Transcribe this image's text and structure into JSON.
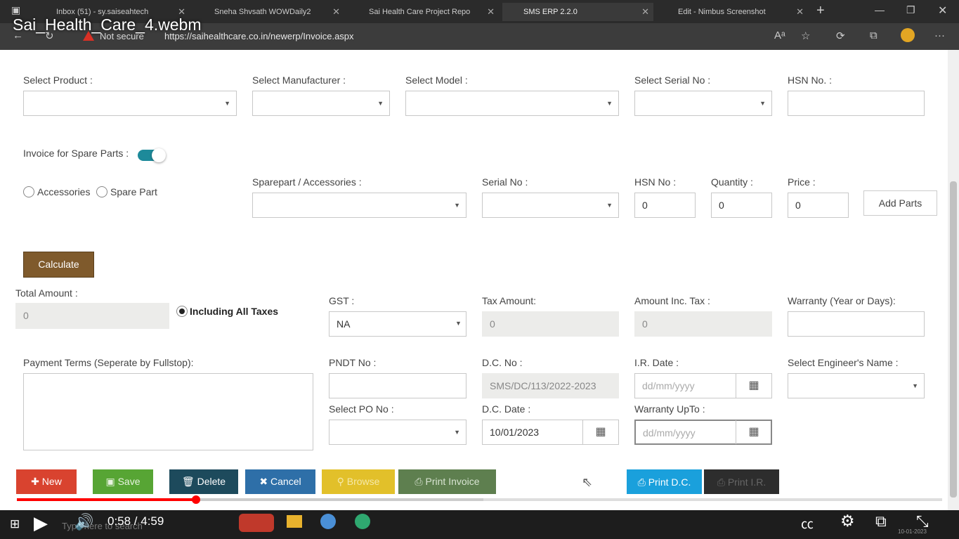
{
  "video": {
    "title": "Sai_Health_Care_4.webm",
    "time": "0:58 / 4:59",
    "progress_played": 0.194,
    "progress_loaded": 0.504
  },
  "browser": {
    "tabs": [
      {
        "label": "Inbox (51) - sy.saiseahtech"
      },
      {
        "label": "Sneha Shvsath WOWDaily2"
      },
      {
        "label": "Sai Health Care Project Repo"
      },
      {
        "label": "SMS ERP 2.2.0"
      },
      {
        "label": "Edit - Nimbus Screenshot"
      }
    ],
    "not_secure": "Not secure",
    "url": "https://saihealthcare.co.in/newerp/Invoice.aspx"
  },
  "form": {
    "select_product_label": "Select Product :",
    "select_manufacturer_label": "Select Manufacturer :",
    "select_model_label": "Select Model :",
    "select_serial_label": "Select Serial No :",
    "hsn_label": "HSN No. :",
    "spare_toggle_label": "Invoice for Spare Parts :",
    "accessories_label": "Accessories",
    "spare_part_label": "Spare Part",
    "sparepart_acc_label": "Sparepart / Accessories :",
    "serial_no_label": "Serial No :",
    "hsn_no_label": "HSN No :",
    "quantity_label": "Quantity :",
    "price_label": "Price :",
    "hsn_no_value": "0",
    "quantity_value": "0",
    "price_value": "0",
    "add_parts": "Add Parts",
    "calculate": "Calculate",
    "total_amount_label": "Total Amount :",
    "total_amount_value": "0",
    "including_taxes": "Including All Taxes",
    "gst_label": "GST :",
    "gst_value": "NA",
    "tax_amount_label": "Tax Amount:",
    "tax_amount_value": "0",
    "amount_inc_tax_label": "Amount Inc. Tax :",
    "amount_inc_tax_value": "0",
    "warranty_label": "Warranty (Year or Days):",
    "payment_terms_label": "Payment Terms (Seperate by Fullstop):",
    "pndt_label": "PNDT No :",
    "dc_no_label": "D.C. No :",
    "dc_no_value": "SMS/DC/113/2022-2023",
    "ir_date_label": "I.R. Date :",
    "ir_date_placeholder": "dd/mm/yyyy",
    "engineer_label": "Select Engineer's Name :",
    "select_po_label": "Select PO No :",
    "dc_date_label": "D.C. Date :",
    "dc_date_value": "10/01/2023",
    "warranty_upto_label": "Warranty UpTo :",
    "warranty_upto_placeholder": "dd/mm/yyyy"
  },
  "actions": {
    "new": "New",
    "save": "Save",
    "delete": "Delete",
    "cancel": "Cancel",
    "browse": "Browse",
    "print_invoice": "Print Invoice",
    "print_dc": "Print D.C.",
    "print_ir": "Print I.R."
  },
  "taskbar": {
    "search_placeholder": "Type here to search",
    "clock_date": "10-01-2023"
  },
  "colors": {
    "new": "#d9432f",
    "save": "#57a534",
    "delete": "#1d4a5c",
    "cancel": "#2e6fa8",
    "browse": "#e2c02a",
    "print_invoice": "#5e7f4f",
    "print_dc": "#1aa0dc",
    "print_ir": "#2d2d2d",
    "calculate": "#7f5a2c",
    "toggle": "#1d8a9a"
  }
}
